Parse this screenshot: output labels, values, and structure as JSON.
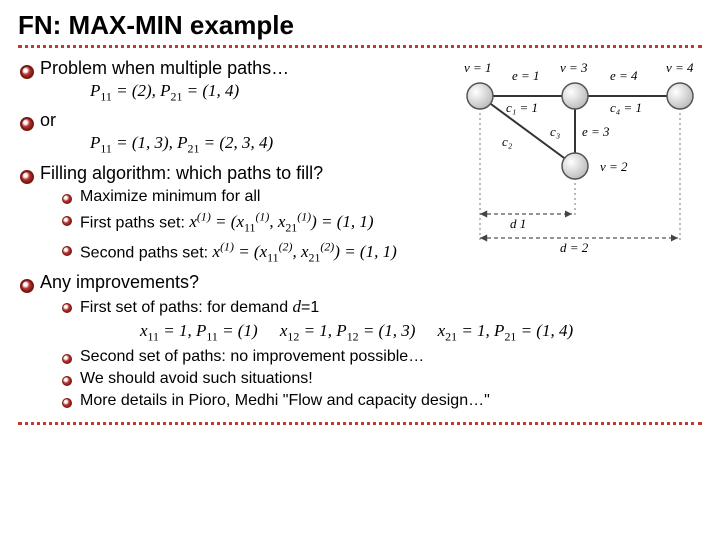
{
  "title": "FN: MAX-MIN example",
  "bullets": {
    "b1": "Problem when multiple paths…",
    "f1": "P₁₁ = (2), P₂₁ = (1, 4)",
    "b2": "or",
    "f2": "P₁₁ = (1, 3), P₂₁ = (2, 3, 4)",
    "b3": "Filling algorithm: which paths to fill?",
    "s3a": "Maximize minimum for all",
    "s3b_pre": "First paths set: ",
    "s3b_math": "x⁽¹⁾ = (x₁₁⁽¹⁾, x₂₁⁽¹⁾) = (1, 1)",
    "s3c_pre": "Second paths set: ",
    "s3c_math": "x⁽¹⁾ = (x₁₁⁽²⁾, x₂₁⁽²⁾) = (1, 1)",
    "b4": "Any improvements?",
    "s4a_pre": "First set of paths: for demand ",
    "s4a_var": "d",
    "s4a_eq": "=1",
    "s4a_f": "x₁₁ = 1, P₁₁ = (1)    x₁₂ = 1, P₁₂ = (1, 3)    x₂₁ = 1, P₂₁ = (1, 4)",
    "s4b": "Second set of paths: no improvement possible…",
    "s4c": "We should avoid such situations!",
    "s4d": "More details in Pioro, Medhi \"Flow and capacity design…\""
  },
  "graph": {
    "nodes": {
      "n1": "v = 1",
      "n2": "v = 3",
      "n3": "v = 4",
      "n4": "v = 2"
    },
    "edges": {
      "e1": "e = 1",
      "e2": "e = 4",
      "c1": "c₁ = 1",
      "c4": "c₄ = 1",
      "c2": "c₂",
      "c3": "c₃",
      "e3": "e = 3"
    },
    "dims": {
      "d1": "d   1",
      "d2": "d = 2"
    }
  }
}
